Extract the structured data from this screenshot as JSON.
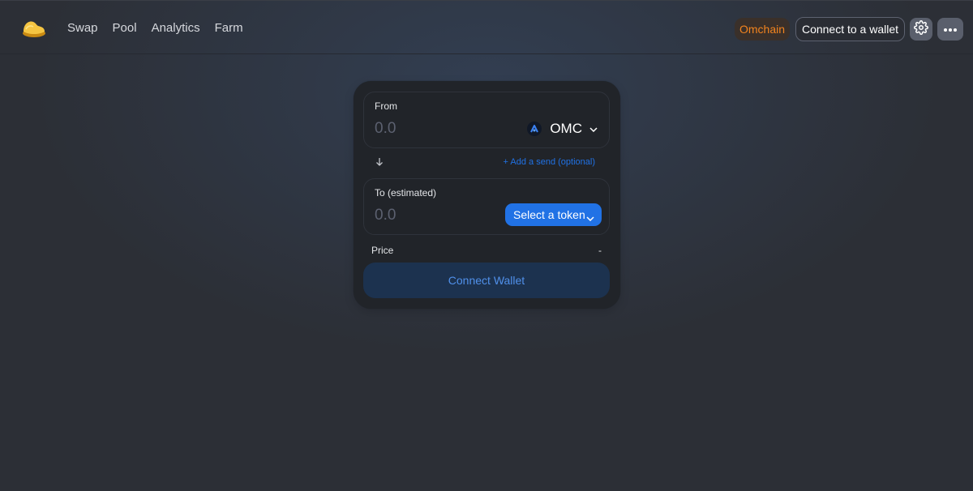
{
  "header": {
    "logo_icon": "bread-slice-icon",
    "nav": [
      {
        "label": "Swap"
      },
      {
        "label": "Pool"
      },
      {
        "label": "Analytics"
      },
      {
        "label": "Farm"
      }
    ],
    "chain_badge": "Omchain",
    "connect_label": "Connect to a wallet",
    "settings_icon": "gear-icon",
    "more_icon": "more-horizontal-icon"
  },
  "swap": {
    "from": {
      "label": "From",
      "amount_placeholder": "0.0",
      "token_symbol": "OMC",
      "token_icon": "omc-token-icon"
    },
    "swap_direction_icon": "arrow-down-icon",
    "add_send_label": "+ Add a send (optional)",
    "to": {
      "label": "To (estimated)",
      "amount_placeholder": "0.0",
      "select_token_label": "Select a token"
    },
    "price_label": "Price",
    "price_value": "-",
    "connect_wallet_label": "Connect Wallet"
  },
  "colors": {
    "background": "#2c2f36",
    "card": "#212429",
    "accent": "#2172e5",
    "chain_badge_text": "#f3841e",
    "connect_wallet_bg": "#1c324f",
    "connect_wallet_text": "#5090ea"
  }
}
